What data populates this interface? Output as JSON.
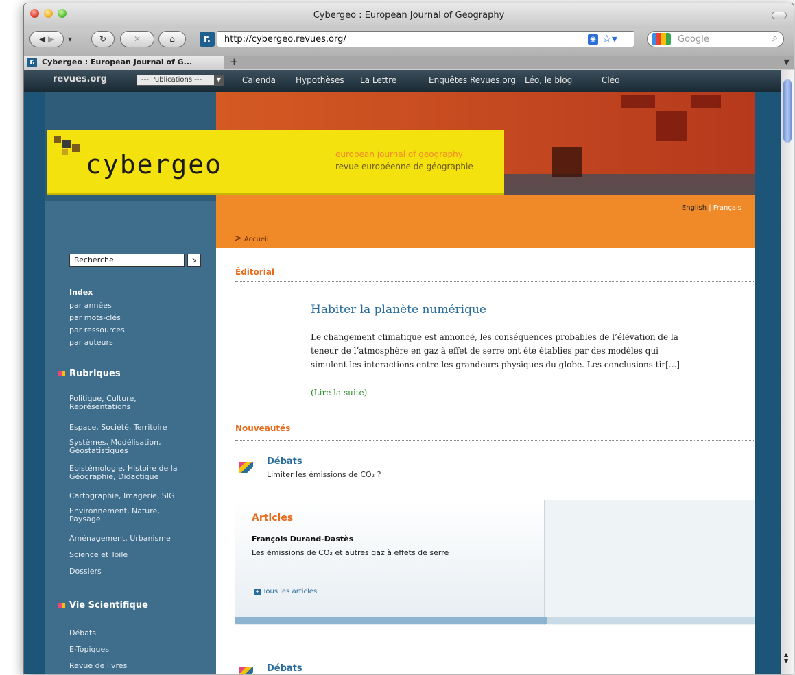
{
  "window": {
    "title": "Cybergeo : European Journal of Geography"
  },
  "toolbar": {
    "url": "http://cybergeo.revues.org/",
    "search_placeholder": "Google"
  },
  "tab": {
    "label": "Cybergeo : European Journal of G...",
    "new_tab": "+"
  },
  "portal": {
    "logo": "revues.org",
    "publications": "--- Publications ---",
    "links": [
      "Calenda",
      "Hypothèses",
      "La Lettre",
      "Enquêtes Revues.org",
      "Léo, le blog",
      "Cléo"
    ]
  },
  "banner": {
    "brand": "cybergeo",
    "tagline_en": "european journal of geography",
    "tagline_fr": "revue européenne de géographie",
    "lang_en": "English",
    "lang_sep": "|",
    "lang_fr": "Français",
    "breadcrumb": "Accueil"
  },
  "sidebar": {
    "search_value": "Recherche",
    "index_title": "Index",
    "index_links": [
      "par années",
      "par mots-clés",
      "par ressources",
      "par auteurs"
    ],
    "rubriques_title": "Rubriques",
    "rubriques": [
      "Politique, Culture, Représentations",
      "Espace, Société, Territoire",
      "Systèmes, Modélisation, Géostatistiques",
      "Epistémologie, Histoire de la Géographie, Didactique",
      "Cartographie, Imagerie, SIG",
      "Environnement, Nature, Paysage",
      "Aménagement, Urbanisme",
      "Science et Toile",
      "Dossiers"
    ],
    "vie_title": "Vie Scientifique",
    "vie_links": [
      "Débats",
      "E-Topiques",
      "Revue de livres"
    ]
  },
  "main": {
    "editorial_label": "Éditorial",
    "editorial_title": "Habiter la planète numérique",
    "editorial_text": "Le changement climatique est annoncé, les conséquences probables de l’élévation de la teneur de l’atmosphère en gaz à effet de serre ont été établies par des modèles qui simulent les interactions entre les grandeurs physiques du globe. Les conclusions tir[...]",
    "editorial_more": "(Lire la suite)",
    "nouveautes_label": "Nouveautés",
    "news1_title": "Débats",
    "news1_text": "Limiter les émissions de CO₂ ?",
    "articles_title": "Articles",
    "article_author": "François Durand-Dastès",
    "article_title": "Les émissions de CO₂ et autres gaz à effets de serre",
    "all_articles": "Tous les articles",
    "news2_title": "Débats"
  }
}
